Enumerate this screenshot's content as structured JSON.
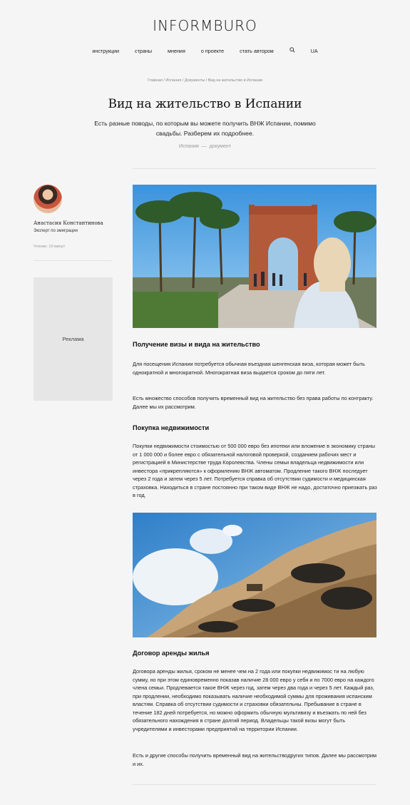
{
  "header": {
    "logo": "INFORMBURO",
    "nav": [
      "инструкции",
      "страны",
      "мнения",
      "о проекте",
      "стать автором"
    ],
    "lang": "UA"
  },
  "breadcrumb": "Главная / Испания / Документы / Вид на жительство в Испании",
  "article": {
    "title": "Вид на жительство в Испании",
    "lead": "Есть разные поводы, по которым вы можете получить ВНЖ Испании, помимо свадьбы. Разберем их подробнее.",
    "tags": [
      "Испания",
      "документ"
    ],
    "sections": [
      {
        "heading": "Получение визы и вида на жительство",
        "paragraphs": [
          "Для посещения Испании потребуется обычная въездная шенгенская виза, которая может быть однократной и многократной. Многократная виза выдается сроком до пяти лет.",
          "Есть множество способов получить временный вид на жительство без права работы по контракту. Далее мы их рассмотрим."
        ]
      },
      {
        "heading": "Покупка недвижимости",
        "paragraphs": [
          "Покупки недвижимости стоимостью от 500 000 евро без ипотеки или вложение в экономику страны от 1 000 000 и более евро с обязательной налоговой проверкой, созданием рабочих мест и регистрацией в Министерстве труда Королевства. Члены семьи владельца недвижимости или инвестора «прикрепляются» к оформлению ВНЖ автоматом.  Продление такого ВНЖ последует через 2 года и затем через 5 лет. Потребуется справка об отсутствии судимости и медицинская страховка. Находиться в стране постоянно при таком виде ВНЖ не надо, достаточно приезжать раз в год."
        ]
      },
      {
        "heading": "Договор аренды жилья",
        "paragraphs": [
          "Договора аренды жилья, сроком не менее чем на 2 года или покупки недвижимос ти на любую сумму, но при этом единовременно показав наличие 28 000 евро у себя и по 7000 евро на каждого члена семьи. Продлевается такое ВНЖ через год, затем через два года и через 5 лет. Каждый раз, при продлении, необходимо показывать наличие необходимой суммы для проживания испанским властям. Справка об отсутствии судимости и страховки обязательны. Пребывание в стране в течение 182 дней потребуется, но можно оформить обычную мультивизу и въезжать по ней без обязательного нахождения в стране долгий период. Владельцы такой визы могут быть учредителями и инвесторами предприятий на территории Испании.",
          "Есть и другие способы получить временный вид на жительстводругих типов. Далее мы рассмотрим и их."
        ]
      }
    ]
  },
  "author": {
    "name": "Анастасия Константинова",
    "role": "Эксперт по эмиграции",
    "reading": "Чтение: 10 минут"
  },
  "ad_label": "Реклама",
  "colors": {
    "background": "#f5f5f5",
    "ad": "#e6e6e6",
    "sky": "#4a9ee0",
    "brick": "#b25a3a"
  }
}
